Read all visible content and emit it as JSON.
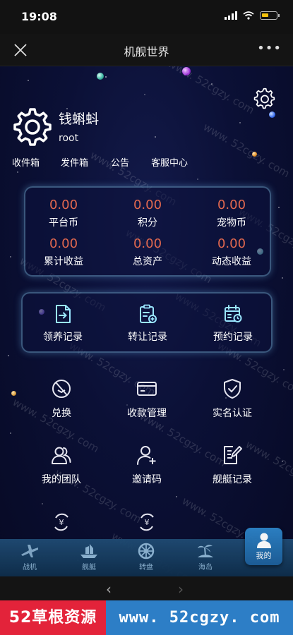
{
  "status_bar": {
    "time": "19:08"
  },
  "nav": {
    "title": "机舰世界",
    "more": "•••"
  },
  "profile": {
    "name": "钱蝌蚪",
    "id": "root"
  },
  "quick_links": [
    "收件箱",
    "发件箱",
    "公告",
    "客服中心"
  ],
  "assets": [
    {
      "value": "0.00",
      "label": "平台币"
    },
    {
      "value": "0.00",
      "label": "积分"
    },
    {
      "value": "0.00",
      "label": "宠物币"
    },
    {
      "value": "0.00",
      "label": "累计收益"
    },
    {
      "value": "0.00",
      "label": "总资产"
    },
    {
      "value": "0.00",
      "label": "动态收益"
    }
  ],
  "records": [
    {
      "label": "领养记录",
      "icon": "adopt-record-icon"
    },
    {
      "label": "转让记录",
      "icon": "transfer-record-icon"
    },
    {
      "label": "预约记录",
      "icon": "reservation-record-icon"
    }
  ],
  "menu": [
    {
      "label": "兑换",
      "icon": "exchange-icon"
    },
    {
      "label": "收款管理",
      "icon": "card-icon"
    },
    {
      "label": "实名认证",
      "icon": "shield-check-icon"
    },
    {
      "label": "我的团队",
      "icon": "team-icon"
    },
    {
      "label": "邀请码",
      "icon": "invite-user-icon"
    },
    {
      "label": "舰艇记录",
      "icon": "document-edit-icon"
    }
  ],
  "bottom_nav": [
    {
      "label": "战机",
      "icon": "fighter-icon"
    },
    {
      "label": "舰艇",
      "icon": "ship-icon"
    },
    {
      "label": "转盘",
      "icon": "wheel-icon"
    },
    {
      "label": "海岛",
      "icon": "island-icon"
    },
    {
      "label": "我的",
      "icon": "user-icon",
      "active": true
    }
  ],
  "browser": {
    "back": "‹",
    "forward": "›"
  },
  "banner": {
    "left": "52草根资源",
    "right": "www. 52cgzy. com"
  },
  "watermark": "www. 52cgzy. com",
  "colors": {
    "asset_value": "#e2684f",
    "accent": "#2d83c7",
    "banner_red": "#e3233a",
    "banner_blue": "#2d7ec6"
  }
}
